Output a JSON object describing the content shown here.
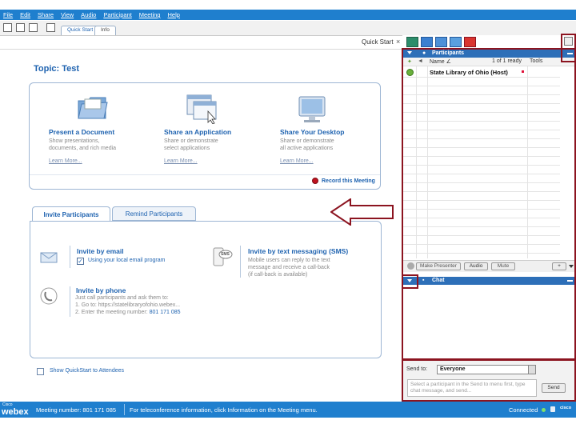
{
  "menu": [
    "File",
    "Edit",
    "Share",
    "View",
    "Audio",
    "Participant",
    "Meeting",
    "Help"
  ],
  "toolbar": {
    "tabs": [
      "Quick Start",
      "Info"
    ]
  },
  "quickstart_label": "Quick Start",
  "close_glyph": "×",
  "topic": "Topic: Test",
  "features": [
    {
      "title": "Present a Document",
      "desc1": "Show presentations,",
      "desc2": "documents, and rich media",
      "link": "Learn More..."
    },
    {
      "title": "Share an Application",
      "desc1": "Share or demonstrate",
      "desc2": "select applications",
      "link": "Learn More..."
    },
    {
      "title": "Share Your Desktop",
      "desc1": "Share or demonstrate",
      "desc2": "all active applications",
      "link": "Learn More..."
    }
  ],
  "record": "Record this Meeting",
  "invite_tabs": [
    "Invite Participants",
    "Remind Participants"
  ],
  "invite": {
    "email_title": "Invite by email",
    "email_option": "Using your local email program",
    "sms_title": "Invite by text messaging (SMS)",
    "sms_line1": "Mobile users can reply to the text",
    "sms_line2": "message and receive a call-back",
    "sms_line3": "(if call-back is available)",
    "sms_badge": "SMS",
    "phone_title": "Invite by phone",
    "phone_line1": "Just call participants and ask them to:",
    "phone_line2": "1. Go to: https://statelibraryofohio.webex...",
    "phone_line3_prefix": "2. Enter the meeting number:",
    "phone_number": "801 171 085"
  },
  "show_quickstart": "Show QuickStart to Attendees",
  "participants": {
    "header": "Participants",
    "col_name": "Name",
    "sort": "∠",
    "count": "1 of 1 ready",
    "col_tools": "Tools",
    "rows": [
      {
        "name": "State Library of Ohio (Host)"
      }
    ],
    "buttons": [
      "Make Presenter",
      "Audio",
      "Mute"
    ],
    "add_label": "+"
  },
  "chat": {
    "header": "Chat",
    "send_to_label": "Send to:",
    "send_to_value": "Everyone",
    "placeholder": "Select a participant in the Send to menu first, type chat message, and send...",
    "send_button": "Send"
  },
  "status": {
    "brand_top": "Cisco",
    "brand": "webex",
    "meeting_number": "Meeting number: 801 171 085",
    "info": "For teleconference information, click Information on the Meeting menu.",
    "connected": "Connected",
    "cisco_logo": "cisco"
  },
  "colors": {
    "accent": "#1f7fce",
    "link": "#1f63b0",
    "annotation": "#8c1420",
    "ready": "#e0143c"
  }
}
